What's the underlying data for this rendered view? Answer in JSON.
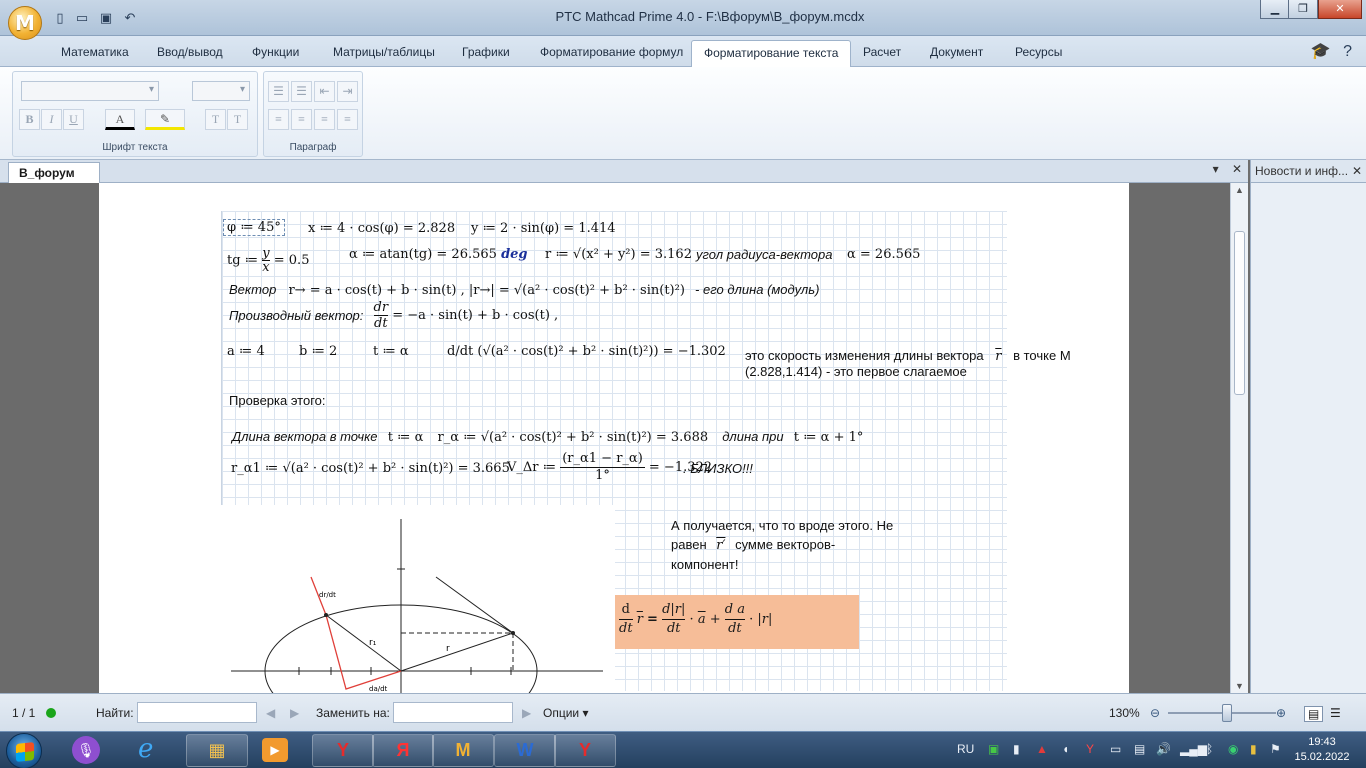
{
  "window": {
    "title": "PTC Mathcad Prime 4.0 - F:\\Вфорум\\В_форум.mcdx",
    "minimize": "▁",
    "maximize": "❐",
    "close": "✕"
  },
  "app_logo": "M",
  "ribbon_tabs": [
    "Математика",
    "Ввод/вывод",
    "Функции",
    "Матрицы/таблицы",
    "Графики",
    "Форматирование формул",
    "Форматирование текста",
    "Расчет",
    "Документ",
    "Ресурсы"
  ],
  "active_tab": "Форматирование текста",
  "ribbon": {
    "font_group_label": "Шрифт текста",
    "paragraph_group_label": "Параграф",
    "bold": "B",
    "italic": "I",
    "underline": "U",
    "text_color": "A",
    "superscript": "T",
    "subscript": "T"
  },
  "document_tab": "В_форум",
  "right_panel_title": "Новости и инф...",
  "doc": {
    "line1": {
      "phi": "φ ≔ 45°",
      "x": "x ≔ 4 · cos(φ) = 2.828",
      "y": "y ≔ 2 · sin(φ) = 1.414"
    },
    "line2": {
      "tg_lhs": "tg ≔",
      "tg_num": "y",
      "tg_den": "x",
      "tg_val": "= 0.5",
      "alpha": "α ≔ atan(tg) = 26.565",
      "alpha_unit": "deg",
      "r": "r ≔ √(x² + y²) = 3.162",
      "comment": "угол радиуса-вектора",
      "alpha_again": "α = 26.565"
    },
    "line3": {
      "label": "Вектор",
      "expr": "r→ = a · cos(t) + b · sin(t) ,  |r→| = √(a² · cos(t)² + b² · sin(t)²)",
      "suffix": "- его длина (модуль)"
    },
    "line4": {
      "label": "Производный вектор:",
      "frac_num": "dr",
      "frac_den": "dt",
      "expr": "= −a · sin(t) + b · cos(t) ,"
    },
    "line5": {
      "a": "a ≔ 4",
      "b": "b ≔ 2",
      "t": "t ≔ α",
      "deriv": "d/dt (√(a² · cos(t)² + b² · sin(t)²)) = −1.302"
    },
    "note1": {
      "line1": "это скорость изменения длины вектора",
      "vec": "r",
      "line1b": "в точке М",
      "line2": "(2.828,1.414)  - это первое слагаемое"
    },
    "check_heading": "Проверка этого:",
    "check_line1": {
      "label": "Длина вектора в точке",
      "t": "t ≔ α",
      "r_alpha": "r_α ≔ √(a² · cos(t)² + b² · sin(t)²) = 3.688",
      "label2": "длина при",
      "t2": "t ≔ α + 1°"
    },
    "check_line2": {
      "r_alpha1": "r_α1 ≔ √(a² · cos(t)² + b² · sin(t)²) = 3.665",
      "v_lhs": "V_Δr ≔",
      "v_num": "(r_α1 − r_α)",
      "v_den": "1°",
      "v_val": "= −1.322",
      "comment": ". БЛИЗКО!!!"
    },
    "note2": {
      "line1": "А получается, что то вроде этого. Не",
      "line2a": "равен",
      "vec": "r′",
      "line2b": "сумме векторов-",
      "line3": "компонент!"
    },
    "formula": {
      "d": "d",
      "dt": "dt",
      "r": "r",
      "eq_part": "d|r|",
      "a": "a",
      "plus_part": "d a",
      "abs_r": "|r|"
    },
    "sketch": {
      "r1_label": "r₁",
      "r_label": "r",
      "dr_label": "dr/dt",
      "da_label": "da/dt"
    }
  },
  "status": {
    "page": "1 / 1",
    "find_label": "Найти:",
    "replace_label": "Заменить на:",
    "options_label": "Опции",
    "zoom": "130%",
    "zoom_level_percent": 130
  },
  "taskbar": {
    "lang": "RU",
    "time": "19:43",
    "date": "15.02.2022"
  },
  "colors": {
    "formula_highlight": "#f6bd98",
    "deg_unit": "#1a2f9a",
    "grid": "#dbe4ef"
  }
}
